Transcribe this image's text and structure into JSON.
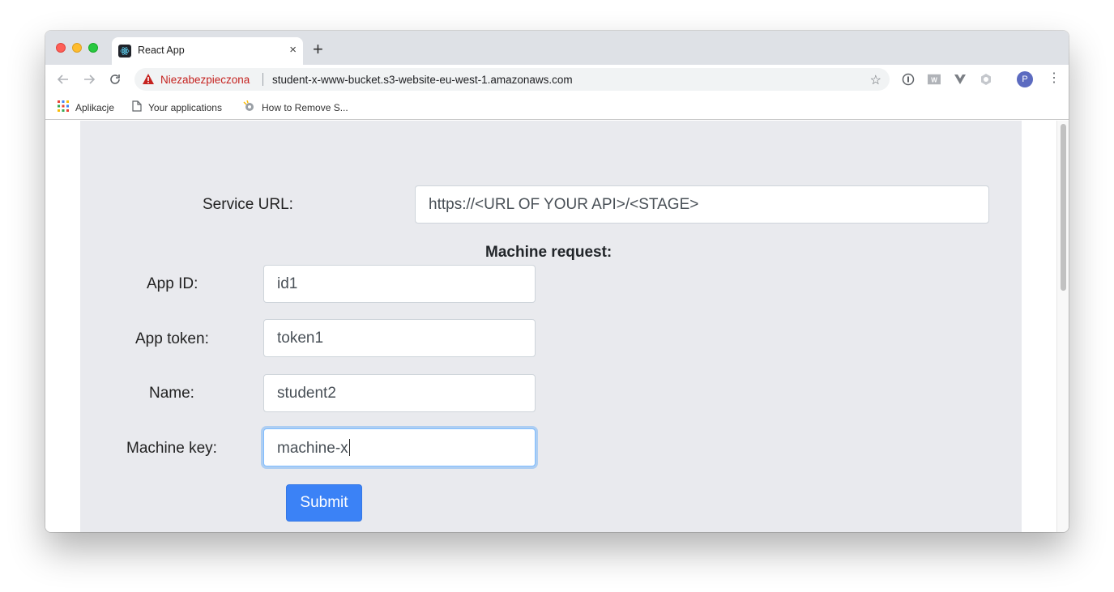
{
  "browser": {
    "tab_title": "React App",
    "tab_close": "×",
    "new_tab": "+",
    "security_label": "Niezabezpieczona",
    "url": "student-x-www-bucket.s3-website-eu-west-1.amazonaws.com",
    "profile_initial": "P",
    "bookmarks": [
      {
        "label": "Aplikacje",
        "icon": "apps-grid-icon"
      },
      {
        "label": "Your applications",
        "icon": "page-icon"
      },
      {
        "label": "How to Remove S...",
        "icon": "site-favicon-icon"
      }
    ]
  },
  "form": {
    "service_url_label": "Service URL:",
    "service_url_value": "https://<URL OF YOUR API>/<STAGE>",
    "section_title": "Machine request:",
    "app_id_label": "App ID:",
    "app_id_value": "id1",
    "app_token_label": "App token:",
    "app_token_value": "token1",
    "name_label": "Name:",
    "name_value": "student2",
    "machine_key_label": "Machine key:",
    "machine_key_value": "machine-x",
    "submit_label": "Submit"
  },
  "colors": {
    "panel_bg": "#e9eaee",
    "submit_bg": "#3b82f6",
    "insecure_text": "#c5221f"
  }
}
